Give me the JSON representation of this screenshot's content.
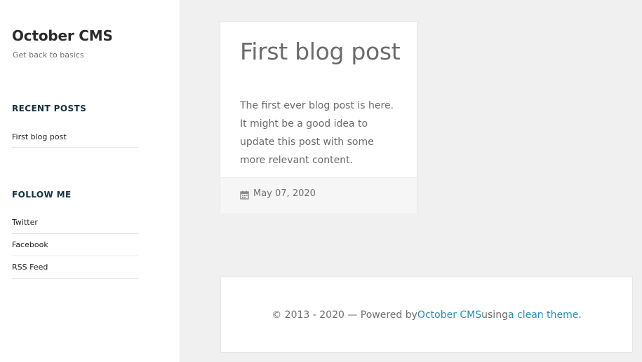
{
  "site": {
    "title": "October CMS",
    "tagline": "Get back to basics"
  },
  "sidebar": {
    "recent_posts": {
      "title": "RECENT POSTS",
      "items": [
        {
          "label": "First blog post"
        }
      ]
    },
    "follow_me": {
      "title": "FOLLOW ME",
      "items": [
        {
          "label": "Twitter"
        },
        {
          "label": "Facebook"
        },
        {
          "label": "RSS Feed"
        }
      ]
    }
  },
  "post": {
    "title": "First blog post",
    "excerpt": "The first ever blog post is here. It might be a good idea to update this post with some more relevant content.",
    "date": "May 07, 2020",
    "date_icon": "calendar-icon"
  },
  "footer": {
    "prefix": "© 2013 - 2020 — Powered by ",
    "cms_link": "October CMS",
    "middle": " using ",
    "theme_link": "a clean theme",
    "suffix": "."
  },
  "colors": {
    "background": "#f0f0f0",
    "panel": "#ffffff",
    "link": "#2a8bb6",
    "heading": "#14303f"
  }
}
